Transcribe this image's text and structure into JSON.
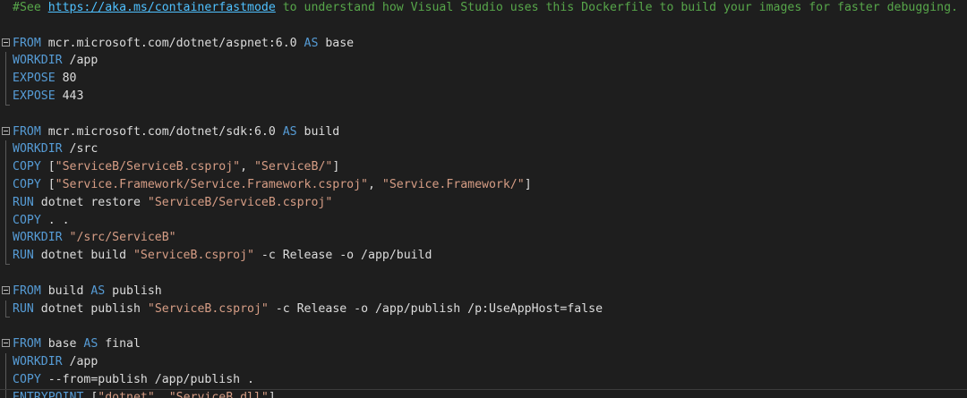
{
  "editor": {
    "comment": {
      "prefix": "#See ",
      "link": "https://aka.ms/containerfastmode",
      "suffix": " to understand how Visual Studio uses this Dockerfile to build your images for faster debugging."
    },
    "stages": [
      {
        "from_kw": "FROM",
        "image": " mcr.microsoft.com/dotnet/aspnet:6.0 ",
        "as_kw": "AS",
        "name": " base",
        "lines": [
          {
            "kw": "WORKDIR",
            "rest": " /app",
            "str": "",
            "tail": ""
          },
          {
            "kw": "EXPOSE",
            "rest": " 80",
            "str": "",
            "tail": ""
          },
          {
            "kw": "EXPOSE",
            "rest": " 443",
            "str": "",
            "tail": ""
          }
        ]
      },
      {
        "from_kw": "FROM",
        "image": " mcr.microsoft.com/dotnet/sdk:6.0 ",
        "as_kw": "AS",
        "name": " build",
        "lines": [
          {
            "kw": "WORKDIR",
            "rest": " /src",
            "str": "",
            "tail": ""
          },
          {
            "kw": "COPY",
            "rest": " [",
            "str": "\"ServiceB/ServiceB.csproj\"",
            "tail": ", ",
            "str2": "\"ServiceB/\"",
            "tail2": "]"
          },
          {
            "kw": "COPY",
            "rest": " [",
            "str": "\"Service.Framework/Service.Framework.csproj\"",
            "tail": ", ",
            "str2": "\"Service.Framework/\"",
            "tail2": "]"
          },
          {
            "kw": "RUN",
            "rest": " dotnet restore ",
            "str": "\"ServiceB/ServiceB.csproj\"",
            "tail": ""
          },
          {
            "kw": "COPY",
            "rest": " . .",
            "str": "",
            "tail": ""
          },
          {
            "kw": "WORKDIR",
            "rest": " ",
            "str": "\"/src/ServiceB\"",
            "tail": ""
          },
          {
            "kw": "RUN",
            "rest": " dotnet build ",
            "str": "\"ServiceB.csproj\"",
            "tail": " -c Release -o /app/build"
          }
        ]
      },
      {
        "from_kw": "FROM",
        "image": " build ",
        "as_kw": "AS",
        "name": " publish",
        "lines": [
          {
            "kw": "RUN",
            "rest": " dotnet publish ",
            "str": "\"ServiceB.csproj\"",
            "tail": " -c Release -o /app/publish /p:UseAppHost=false"
          }
        ]
      },
      {
        "from_kw": "FROM",
        "image": " base ",
        "as_kw": "AS",
        "name": " final",
        "lines": [
          {
            "kw": "WORKDIR",
            "rest": " /app",
            "str": "",
            "tail": ""
          },
          {
            "kw": "COPY",
            "rest": " --from=publish /app/publish .",
            "str": "",
            "tail": ""
          },
          {
            "kw": "ENTRYPOINT",
            "rest": " [",
            "str": "\"dotnet\"",
            "tail": ", ",
            "str2": "\"ServiceB.dll\"",
            "tail2": "]"
          }
        ]
      }
    ]
  }
}
